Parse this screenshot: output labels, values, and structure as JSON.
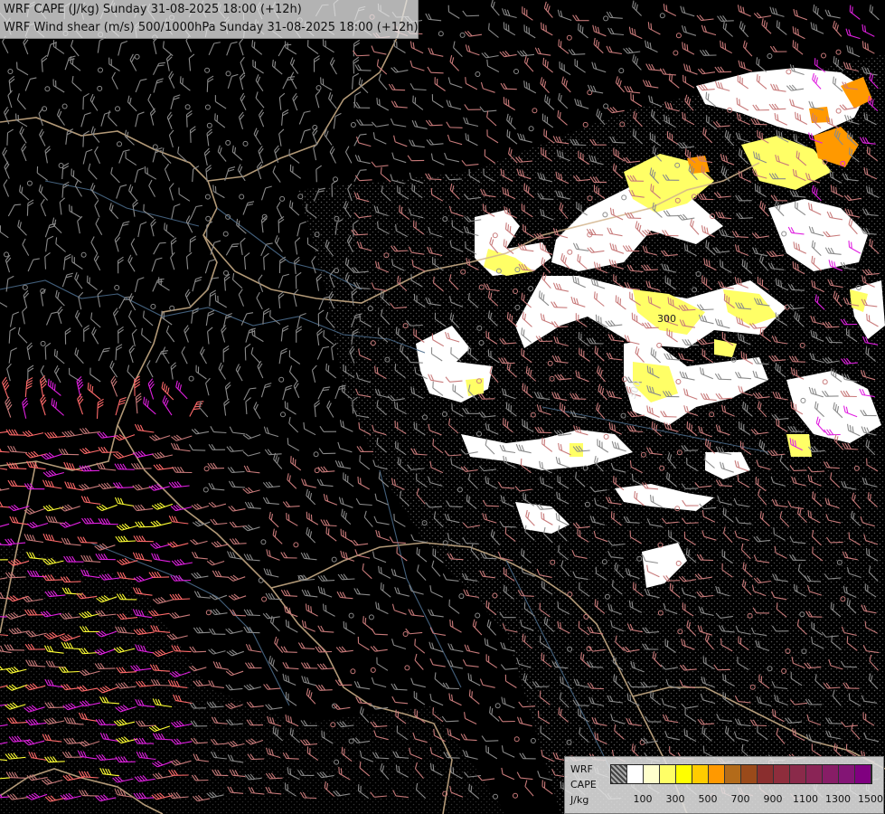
{
  "header": {
    "line1": "WRF CAPE (J/kg) Sunday 31-08-2025 18:00 (+12h)",
    "line2": "WRF Wind shear (m/s) 500/1000hPa Sunday 31-08-2025 18:00 (+12h)"
  },
  "map": {
    "contour_label": "300",
    "contour_label_2": "300"
  },
  "legend": {
    "caption_1": "WRF",
    "caption_2": "CAPE",
    "caption_3": "J/kg",
    "swatch_colors": [
      "#8c8c8c",
      "#ffffff",
      "#ffffcc",
      "#ffff66",
      "#ffff00",
      "#ffcc00",
      "#ff9900",
      "#b36b1a",
      "#9a4a1a",
      "#8a2e2e",
      "#8e2d3c",
      "#8a2a4a",
      "#8a2456",
      "#871d66",
      "#831575",
      "#800080"
    ],
    "tick_labels": [
      "100",
      "300",
      "500",
      "700",
      "900",
      "1100",
      "1300",
      "1500"
    ]
  },
  "colors": {
    "background": "#000000",
    "border": "#d2b48c",
    "river": "#4a6a8a",
    "barb_grey": "#8a8a8a",
    "barb_salmon": "#c87a7a",
    "barb_pink": "#ff6a6a",
    "barb_magenta": "#e020e0",
    "barb_yellow": "#ffff33",
    "cape_white": "#ffffff",
    "cape_yellow": "#ffff66",
    "cape_orange": "#ff9900"
  }
}
